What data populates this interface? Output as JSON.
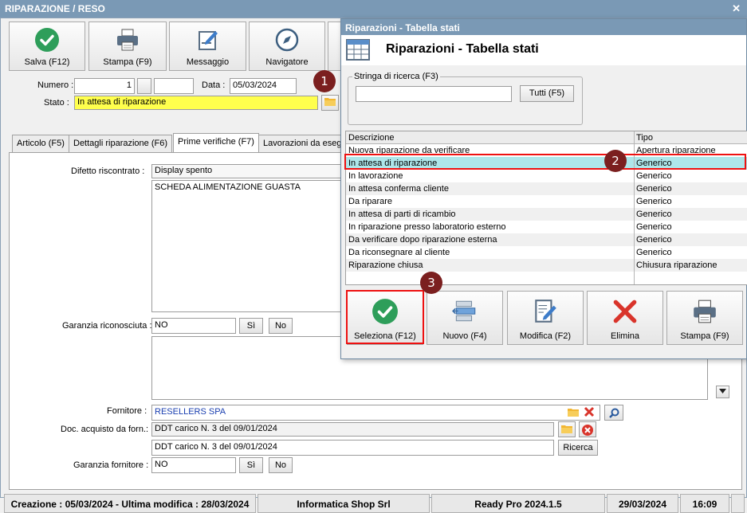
{
  "window": {
    "title": "RIPARAZIONE / RESO",
    "close_glyph": "✕"
  },
  "toolbar": {
    "save_label": "Salva (F12)",
    "print_label": "Stampa (F9)",
    "message_label": "Messaggio",
    "navigator_label": "Navigatore"
  },
  "header_form": {
    "numero_label": "Numero :",
    "numero_value": "1",
    "data_label": "Data :",
    "data_value": "05/03/2024",
    "stato_label": "Stato :",
    "stato_value": "In attesa di riparazione"
  },
  "tabs": [
    {
      "label": "Articolo (F5)"
    },
    {
      "label": "Dettagli riparazione (F6)"
    },
    {
      "label": "Prime verifiche (F7)"
    },
    {
      "label": "Lavorazioni da esegu"
    }
  ],
  "verifiche": {
    "difetto_label": "Difetto riscontrato :",
    "difetto_value": "Display spento",
    "difetto_note": "SCHEDA ALIMENTAZIONE GUASTA",
    "garanzia_label": "Garanzia riconosciuta :",
    "garanzia_value": "NO",
    "si_label": "Sì",
    "no_label": "No",
    "fornitore_label": "Fornitore :",
    "fornitore_value": "RESELLERS SPA",
    "doc_label": "Doc. acquisto da forn.:",
    "doc_value": "DDT carico N. 3 del 09/01/2024",
    "doc_value2": "DDT carico N. 3 del 09/01/2024",
    "ricerca_label": "Ricerca",
    "garanzia_forn_label": "Garanzia fornitore :",
    "garanzia_forn_value": "NO"
  },
  "statusbar": {
    "dates": "Creazione : 05/03/2024 - Ultima modifica : 28/03/2024",
    "company": "Informatica Shop Srl",
    "product": "Ready Pro 2024.1.5",
    "date": "29/03/2024",
    "time": "16:09"
  },
  "dialog": {
    "title": "Riparazioni - Tabella stati",
    "heading": "Riparazioni - Tabella stati",
    "search_group_label": "Stringa di ricerca (F3)",
    "search_value": "",
    "all_button": "Tutti (F5)",
    "col_desc": "Descrizione",
    "col_type": "Tipo",
    "rows": [
      {
        "desc": "Nuova riparazione da verificare",
        "type": "Apertura riparazione"
      },
      {
        "desc": "In attesa di riparazione",
        "type": "Generico"
      },
      {
        "desc": "In lavorazione",
        "type": "Generico"
      },
      {
        "desc": "In attesa conferma cliente",
        "type": "Generico"
      },
      {
        "desc": "Da riparare",
        "type": "Generico"
      },
      {
        "desc": "In attesa di parti di ricambio",
        "type": "Generico"
      },
      {
        "desc": "In riparazione presso laboratorio esterno",
        "type": "Generico"
      },
      {
        "desc": "Da verificare dopo riparazione esterna",
        "type": "Generico"
      },
      {
        "desc": "Da riconsegnare al cliente",
        "type": "Generico"
      },
      {
        "desc": "Riparazione chiusa",
        "type": "Chiusura riparazione"
      }
    ],
    "buttons": {
      "select": "Seleziona (F12)",
      "new": "Nuovo (F4)",
      "edit": "Modifica (F2)",
      "delete": "Elimina",
      "print": "Stampa (F9)"
    }
  },
  "markers": [
    "1",
    "2",
    "3"
  ],
  "colors": {
    "accent_green": "#2e9e5a",
    "delete_red": "#d9342b",
    "highlight_yellow": "#ffff4d",
    "selection_cyan": "#aee6ea",
    "marker_red": "#7b1f1f"
  }
}
